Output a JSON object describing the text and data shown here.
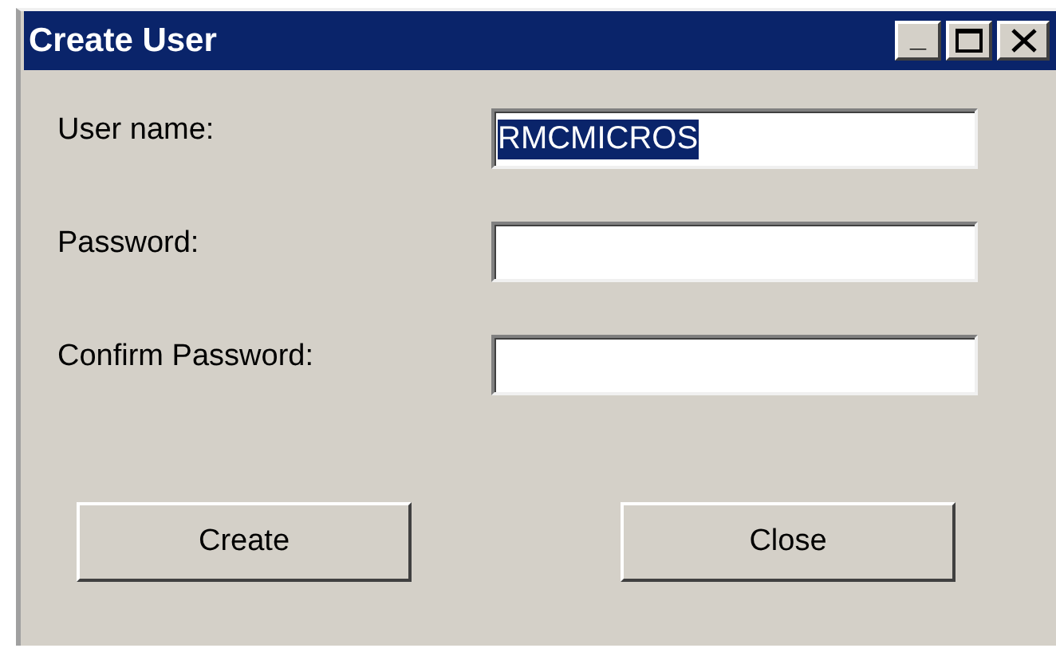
{
  "window": {
    "title": "Create User",
    "controls": [
      {
        "kind": "minimize",
        "label": "_"
      },
      {
        "kind": "maximize"
      },
      {
        "kind": "close"
      }
    ]
  },
  "fields": [
    {
      "label": "User name:",
      "value": "RMCMICROS",
      "text_selected": true
    },
    {
      "label": "Password:"
    },
    {
      "label": "Confirm Password:"
    }
  ],
  "buttons": [
    "Create",
    "Close"
  ]
}
